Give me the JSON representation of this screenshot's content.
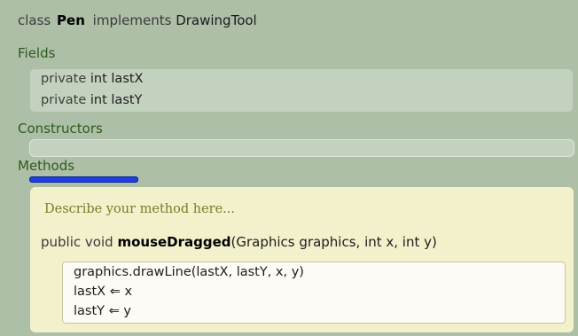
{
  "class_header": {
    "keyword_class": "class",
    "class_name": "Pen",
    "keyword_implements": "implements",
    "interface_name": "DrawingTool"
  },
  "sections": {
    "fields": "Fields",
    "constructors": "Constructors",
    "methods": "Methods"
  },
  "fields": [
    {
      "modifier": "private",
      "declaration": "int lastX"
    },
    {
      "modifier": "private",
      "declaration": "int lastY"
    }
  ],
  "method": {
    "comment": "Describe your method here...",
    "modifier": "public",
    "return_type": "void",
    "name": "mouseDragged",
    "params": "(Graphics graphics,  int x,  int y)",
    "body": [
      "graphics.drawLine(lastX, lastY, x, y)",
      "lastX ⇐ x",
      "lastY ⇐ y"
    ]
  },
  "colors": {
    "background": "#adbfa6",
    "field_box": "#c3d2be",
    "section_label": "#2f5a1e",
    "method_box": "#f3f0cc",
    "method_comment": "#7d7a2b",
    "body_box": "#fcfbf5",
    "focus_underline": "#1f3fe0"
  }
}
